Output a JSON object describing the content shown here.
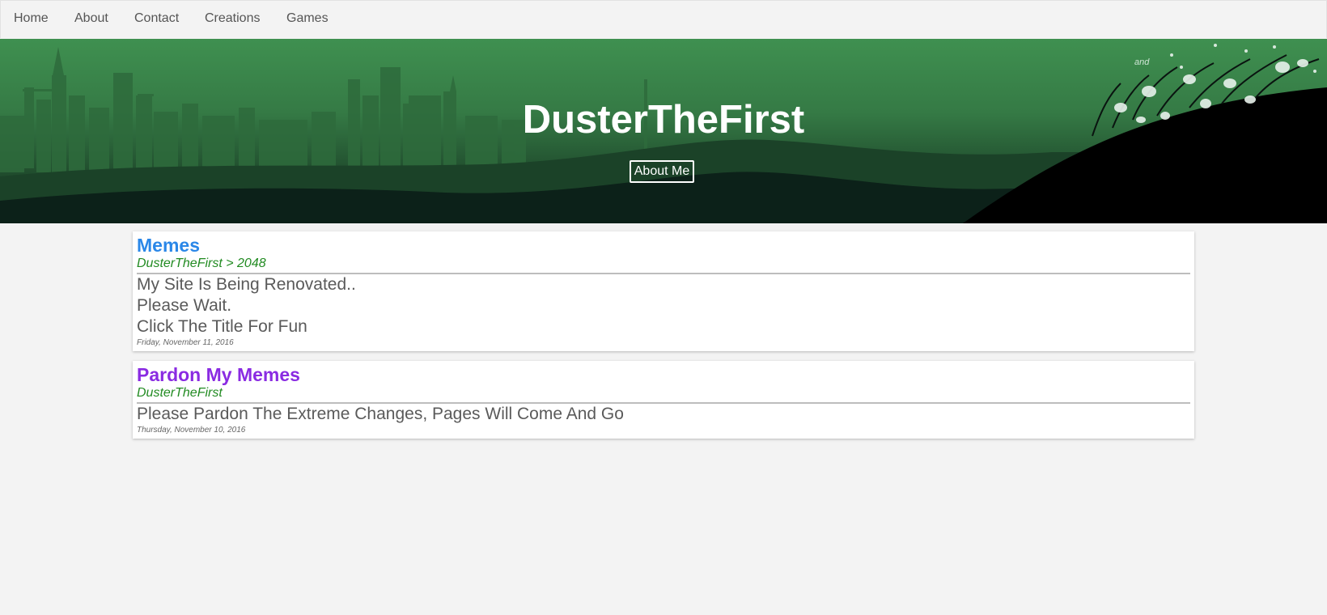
{
  "nav": {
    "items": [
      {
        "label": "Home"
      },
      {
        "label": "About"
      },
      {
        "label": "Contact"
      },
      {
        "label": "Creations"
      },
      {
        "label": "Games"
      }
    ]
  },
  "hero": {
    "title": "DusterTheFirst",
    "button_label": "About Me",
    "bg_text": "and"
  },
  "posts": [
    {
      "title": "Memes",
      "title_color": "#2a87e8",
      "author": "DusterTheFirst > 2048",
      "lines": [
        "My Site Is Being Renovated..",
        "Please Wait.",
        "Click The Title For Fun"
      ],
      "date": "Friday, November 11, 2016"
    },
    {
      "title": "Pardon My Memes",
      "title_color": "#8a2be2",
      "author": "DusterTheFirst",
      "lines": [
        "Please Pardon The Extreme Changes, Pages Will Come And Go"
      ],
      "date": "Thursday, November 10, 2016"
    }
  ]
}
